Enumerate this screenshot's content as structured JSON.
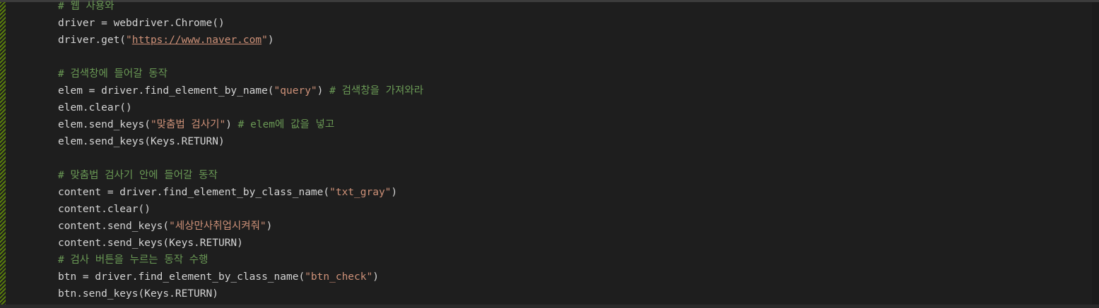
{
  "editor": {
    "language": "python",
    "lines": [
      [
        {
          "t": "# 웹 사용와",
          "c": "comment"
        }
      ],
      [
        {
          "t": "driver = webdriver.Chrome()"
        }
      ],
      [
        {
          "t": "driver.get("
        },
        {
          "t": "\"",
          "c": "string"
        },
        {
          "t": "https://www.naver.com",
          "c": "url"
        },
        {
          "t": "\"",
          "c": "string"
        },
        {
          "t": ")"
        }
      ],
      [],
      [
        {
          "t": "# 검색창에 들어갈 동작",
          "c": "comment"
        }
      ],
      [
        {
          "t": "elem = driver.find_element_by_name("
        },
        {
          "t": "\"query\"",
          "c": "string"
        },
        {
          "t": ") "
        },
        {
          "t": "# 검색창을 가져와라",
          "c": "comment"
        }
      ],
      [
        {
          "t": "elem.clear()"
        }
      ],
      [
        {
          "t": "elem.send_keys("
        },
        {
          "t": "\"맞춤법 검사기\"",
          "c": "string"
        },
        {
          "t": ") "
        },
        {
          "t": "# elem에 값을 넣고",
          "c": "comment"
        }
      ],
      [
        {
          "t": "elem.send_keys(Keys.RETURN)"
        }
      ],
      [],
      [
        {
          "t": "# 맞춤법 검사기 안에 들어갈 동작",
          "c": "comment"
        }
      ],
      [
        {
          "t": "content = driver.find_element_by_class_name("
        },
        {
          "t": "\"txt_gray\"",
          "c": "string"
        },
        {
          "t": ")"
        }
      ],
      [
        {
          "t": "content.clear()"
        }
      ],
      [
        {
          "t": "content.send_keys("
        },
        {
          "t": "\"세상만사취업시켜줘\"",
          "c": "string"
        },
        {
          "t": ")"
        }
      ],
      [
        {
          "t": "content.send_keys(Keys.RETURN)"
        }
      ],
      [
        {
          "t": "# 검사 버튼을 누르는 동작 수행",
          "c": "comment"
        }
      ],
      [
        {
          "t": "btn = driver.find_element_by_class_name("
        },
        {
          "t": "\"btn_check\"",
          "c": "string"
        },
        {
          "t": ")"
        }
      ],
      [
        {
          "t": "btn.send_keys(Keys.RETURN)"
        }
      ]
    ]
  },
  "colors": {
    "background": "#1e1e1e",
    "default_text": "#d4d4d4",
    "comment": "#6a9955",
    "string": "#ce9178",
    "git_modified_marker": "#587c0c"
  }
}
